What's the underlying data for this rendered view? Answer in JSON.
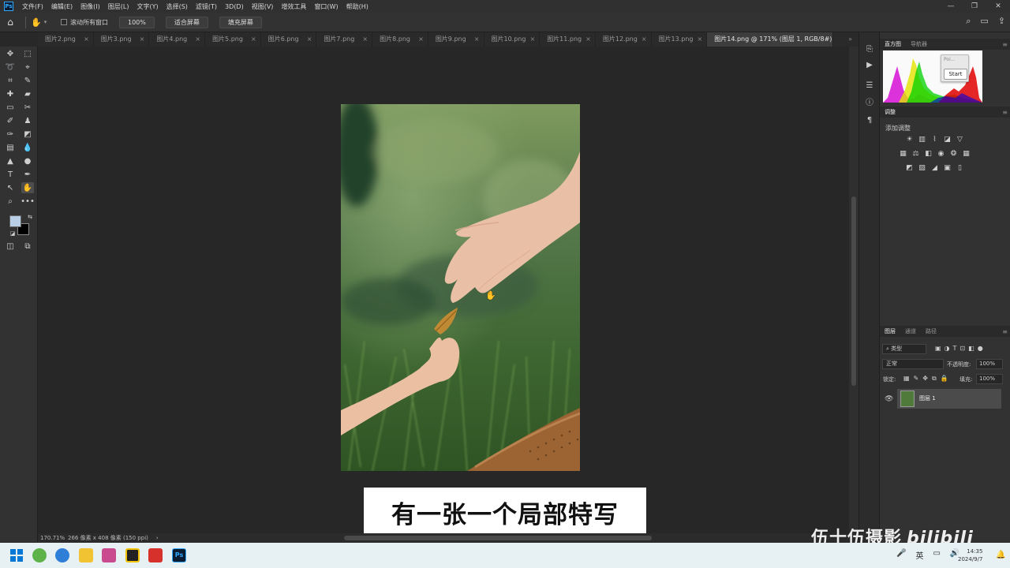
{
  "menubar": {
    "app_icon": "Ps",
    "items": [
      "文件(F)",
      "编辑(E)",
      "图像(I)",
      "图层(L)",
      "文字(Y)",
      "选择(S)",
      "滤镜(T)",
      "3D(D)",
      "视图(V)",
      "增效工具",
      "窗口(W)",
      "帮助(H)"
    ]
  },
  "options": {
    "scroll_all_windows": "滚动所有窗口",
    "zoom_button": "100%",
    "fit_screen": "适合屏幕",
    "fill_screen": "填充屏幕"
  },
  "tabs": [
    {
      "label": "图片2.png"
    },
    {
      "label": "图片3.png"
    },
    {
      "label": "图片4.png"
    },
    {
      "label": "图片5.png"
    },
    {
      "label": "图片6.png"
    },
    {
      "label": "图片7.png"
    },
    {
      "label": "图片8.png"
    },
    {
      "label": "图片9.png"
    },
    {
      "label": "图片10.png"
    },
    {
      "label": "图片11.png"
    },
    {
      "label": "图片12.png"
    },
    {
      "label": "图片13.png"
    },
    {
      "label": "图片14.png @ 171% (图层 1, RGB/8#) *"
    }
  ],
  "status": {
    "zoom": "170.71%",
    "doc_info": "266 像素 x 408 像素 (150 ppi)"
  },
  "subtitle": "有一张一个局部特写",
  "panels": {
    "top_tabs": [
      "直方图",
      "导航器"
    ],
    "popup_text": "Poi...",
    "start_button": "Start",
    "adjustments_tab": "调整",
    "adjustments_title": "添加调整",
    "layers_tabs": [
      "图层",
      "通道",
      "路径"
    ],
    "layer_filter": "类型",
    "blend_mode": "正常",
    "opacity_label": "不透明度:",
    "opacity_value": "100%",
    "lock_label": "锁定:",
    "fill_label": "填充:",
    "fill_value": "100%",
    "layer_name": "图层 1"
  },
  "watermark": {
    "text": "伍十伍摄影",
    "logo": "bilibili"
  },
  "taskbar": {
    "lang": "英",
    "time": "14:35",
    "date": "2024/9/7"
  }
}
